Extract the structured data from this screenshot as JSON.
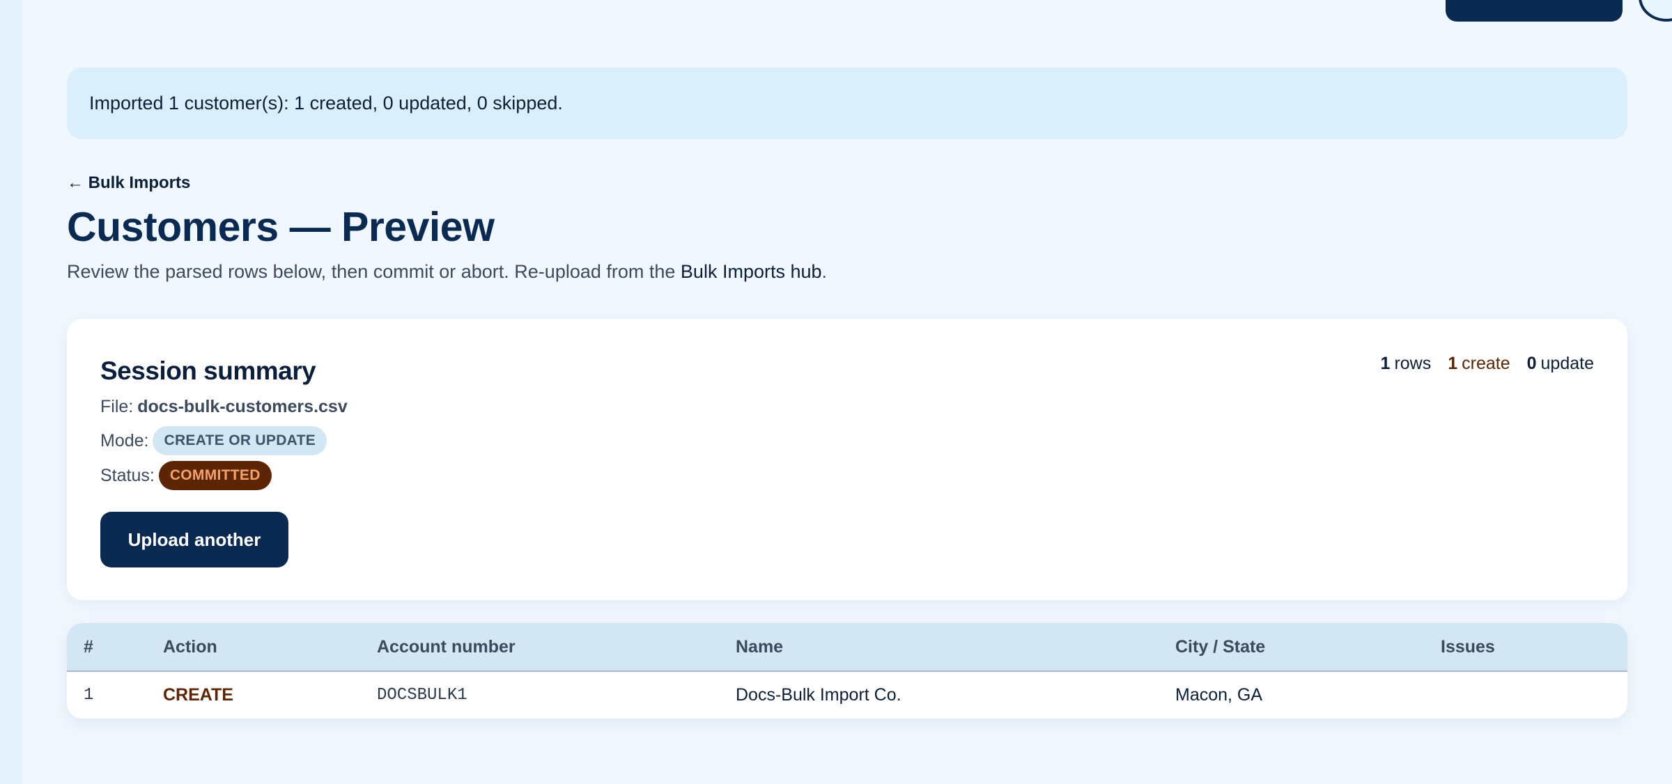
{
  "flash": {
    "message": "Imported 1 customer(s): 1 created, 0 updated, 0 skipped."
  },
  "nav": {
    "back_link": "← Bulk Imports"
  },
  "page": {
    "title": "Customers — Preview",
    "subtitle_prefix": "Review the parsed rows below, then commit or abort. Re-upload from the ",
    "subtitle_link": "Bulk Imports hub",
    "subtitle_suffix": "."
  },
  "summary": {
    "title": "Session summary",
    "file_label": "File:",
    "file_value": "docs-bulk-customers.csv",
    "mode_label": "Mode:",
    "mode_value": "CREATE OR UPDATE",
    "status_label": "Status:",
    "status_value": "COMMITTED",
    "upload_button": "Upload another",
    "counts": {
      "rows_value": "1",
      "rows_label": "rows",
      "create_value": "1",
      "create_label": "create",
      "update_value": "0",
      "update_label": "update"
    }
  },
  "table": {
    "columns": [
      "#",
      "Action",
      "Account number",
      "Name",
      "City / State",
      "Issues"
    ],
    "rows": [
      {
        "num": "1",
        "action": "CREATE",
        "account": "DOCSBULK1",
        "name": "Docs-Bulk Import Co.",
        "city_state": "Macon, GA",
        "issues": ""
      }
    ]
  },
  "colors": {
    "navy": "#0a2a52",
    "status_badge_bg": "#5c2606",
    "status_badge_text": "#f6a169",
    "mode_badge_bg": "#d3e6f4",
    "flash_bg": "#daeefb"
  }
}
